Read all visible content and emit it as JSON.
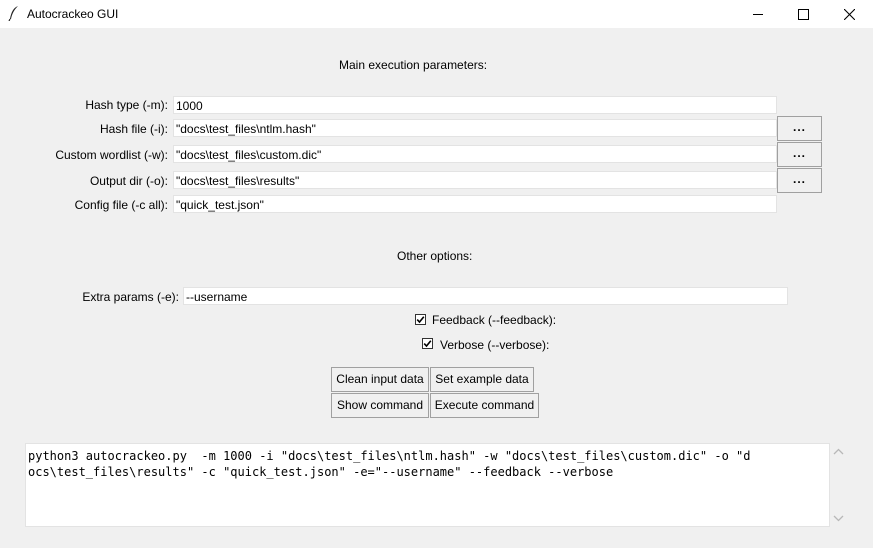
{
  "window": {
    "title": "Autocrackeo GUI"
  },
  "main": {
    "heading": "Main execution parameters:",
    "fields": [
      {
        "label": "Hash type (-m):",
        "value": "1000"
      },
      {
        "label": "Hash file (-i):",
        "value": "\"docs\\test_files\\ntlm.hash\""
      },
      {
        "label": "Custom wordlist (-w):",
        "value": "\"docs\\test_files\\custom.dic\""
      },
      {
        "label": "Output dir (-o):",
        "value": "\"docs\\test_files\\results\""
      },
      {
        "label": "Config file (-c all):",
        "value": "\"quick_test.json\""
      }
    ],
    "browse_label": "..."
  },
  "other": {
    "heading": "Other options:",
    "extra_label": "Extra params (-e):",
    "extra_value": "--username",
    "feedback_label": "Feedback (--feedback):",
    "feedback_checked": true,
    "verbose_label": "Verbose (--verbose):",
    "verbose_checked": true
  },
  "buttons": {
    "clean": "Clean input data",
    "example": "Set example data",
    "show": "Show command",
    "execute": "Execute command"
  },
  "output": {
    "line1": "python3 autocrackeo.py  -m 1000 -i \"docs\\test_files\\ntlm.hash\" -w \"docs\\test_files\\custom.dic\" -o \"d",
    "line2": "ocs\\test_files\\results\" -c \"quick_test.json\" -e=\"--username\" --feedback --verbose"
  }
}
